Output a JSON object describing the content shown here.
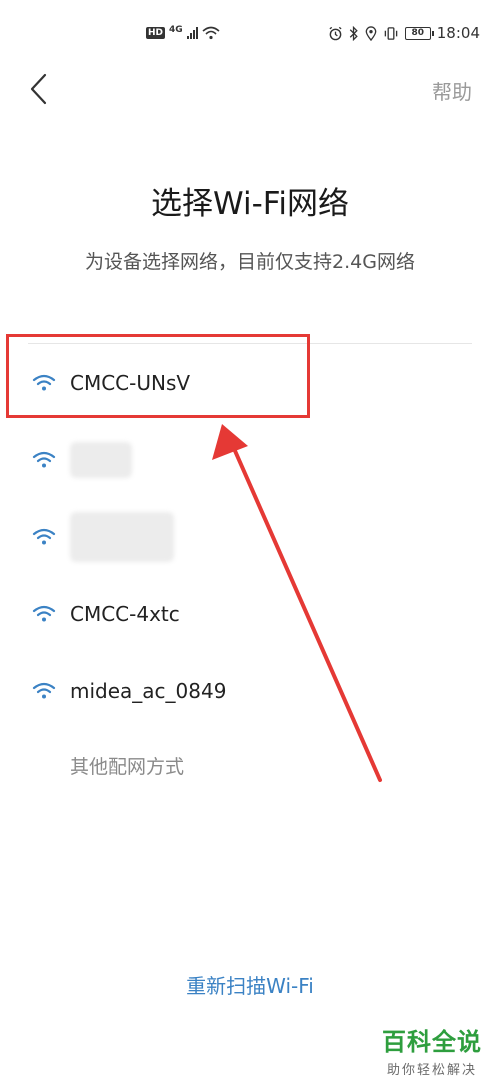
{
  "status_bar": {
    "hd_label": "HD",
    "network_label": "4G",
    "battery_level": "80",
    "time": "18:04"
  },
  "header": {
    "back_icon": "chevron-left-icon",
    "help_label": "帮助"
  },
  "title": "选择Wi-Fi网络",
  "subtitle": "为设备选择网络，目前仅支持2.4G网络",
  "wifi_networks": [
    {
      "name": "CMCC-UNsV",
      "highlighted": true
    },
    {
      "name": "",
      "obscured": true
    },
    {
      "name": "",
      "obscured": true
    },
    {
      "name": "CMCC-4xtc"
    },
    {
      "name": "midea_ac_0849"
    }
  ],
  "other_methods_label": "其他配网方式",
  "rescan_label": "重新扫描Wi-Fi",
  "colors": {
    "accent_blue": "#3b82c4",
    "annotation_red": "#e53935",
    "watermark_green": "#2e9e3e"
  },
  "watermark": {
    "main": "百科全说",
    "sub": "助你轻松解决"
  }
}
